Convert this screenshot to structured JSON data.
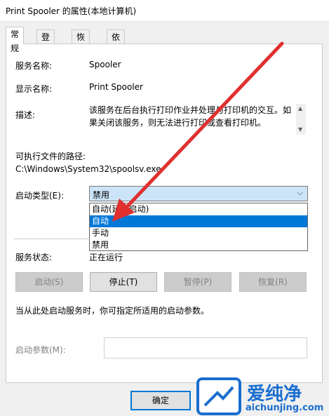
{
  "window": {
    "title": "Print Spooler 的属性(本地计算机)"
  },
  "tabs": [
    {
      "label": "常规",
      "active": true
    },
    {
      "label": "登录",
      "active": false
    },
    {
      "label": "恢复",
      "active": false
    },
    {
      "label": "依存关系",
      "active": false
    }
  ],
  "general": {
    "service_name_label": "服务名称:",
    "service_name_value": "Spooler",
    "display_name_label": "显示名称:",
    "display_name_value": "Print Spooler",
    "description_label": "描述:",
    "description_value": "该服务在后台执行打印作业并处理与打印机的交互。如果关闭该服务，则无法进行打印或查看打印机。",
    "exe_path_label": "可执行文件的路径:",
    "exe_path_value": "C:\\Windows\\System32\\spoolsv.exe",
    "startup_type_label": "启动类型(E):",
    "startup_type_value": "禁用",
    "startup_options": [
      "自动(延迟启动)",
      "自动",
      "手动",
      "禁用"
    ],
    "startup_highlighted_index": 1,
    "status_label": "服务状态:",
    "status_value": "正在运行",
    "start_button": "启动(S)",
    "stop_button": "停止(T)",
    "pause_button": "暂停(P)",
    "resume_button": "恢复(R)",
    "hint_text": "当从此处启动服务时，你可指定所适用的启动参数。",
    "params_label": "启动参数(M):",
    "params_value": ""
  },
  "footer": {
    "ok_button": "确定"
  },
  "watermark": {
    "brand": "爱纯净",
    "url": "aichunjing.com",
    "accent": "#1a6ecf"
  },
  "colors": {
    "selection": "#0078d7",
    "arrow": "#e03030"
  }
}
